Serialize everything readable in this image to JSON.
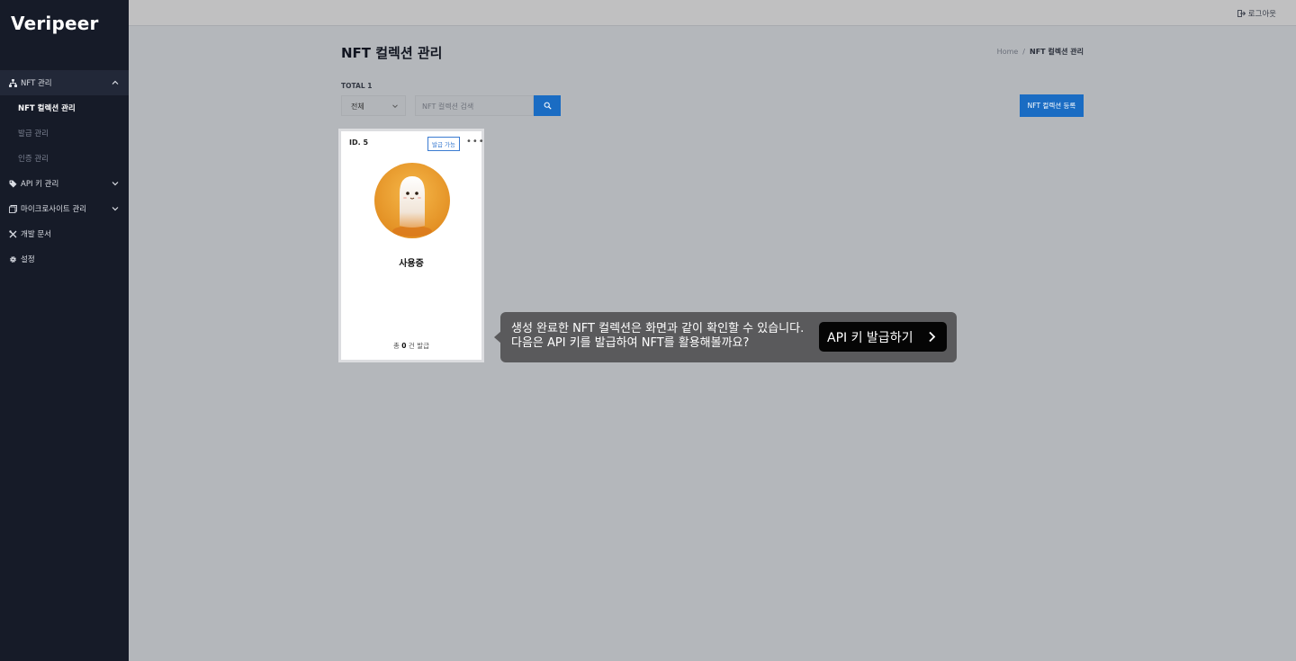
{
  "app": {
    "logo_text": "Veripeer"
  },
  "header": {
    "logout_label": "로그아웃"
  },
  "sidebar": {
    "groups": [
      {
        "label": "NFT 관리",
        "icon": "sitemap-icon",
        "expanded": true,
        "items": [
          "NFT 컬렉션 관리",
          "발급 관리",
          "인증 관리"
        ],
        "current": "NFT 컬렉션 관리"
      },
      {
        "label": "API 키 관리",
        "icon": "tag-icon",
        "expanded": false
      },
      {
        "label": "마이크로사이트 관리",
        "icon": "window-icon",
        "expanded": false
      },
      {
        "label": "개발 문서",
        "icon": "tools-icon"
      },
      {
        "label": "설정",
        "icon": "gear-icon"
      }
    ]
  },
  "page": {
    "title": "NFT 컬렉션 관리",
    "breadcrumb": {
      "home": "Home",
      "sep": "/",
      "current": "NFT 컬렉션 관리"
    },
    "total_label": "TOTAL 1",
    "filter": {
      "selected": "전체"
    },
    "search": {
      "placeholder": "NFT 컬렉션 검색"
    },
    "register_button": "NFT 컬렉션 등록"
  },
  "card": {
    "id_label": "ID. 5",
    "badge": "발급 가능",
    "name": "사용증",
    "count_prefix": "총",
    "count_value": "0",
    "count_suffix": "건 발급",
    "image_colors": {
      "bg": "#e89a2c",
      "ghost": "#f3eee8"
    }
  },
  "tooltip": {
    "line1": "생성 완료한 NFT 컬렉션은 화면과 같이 확인할 수 있습니다.",
    "line2": "다음은 API 키를 발급하여 NFT를 활용해볼까요?",
    "button_label": "API 키 발급하기"
  },
  "colors": {
    "sidebar_bg": "#161b28",
    "accent": "#1a6cc3",
    "overlay": "#b4b7bb"
  }
}
